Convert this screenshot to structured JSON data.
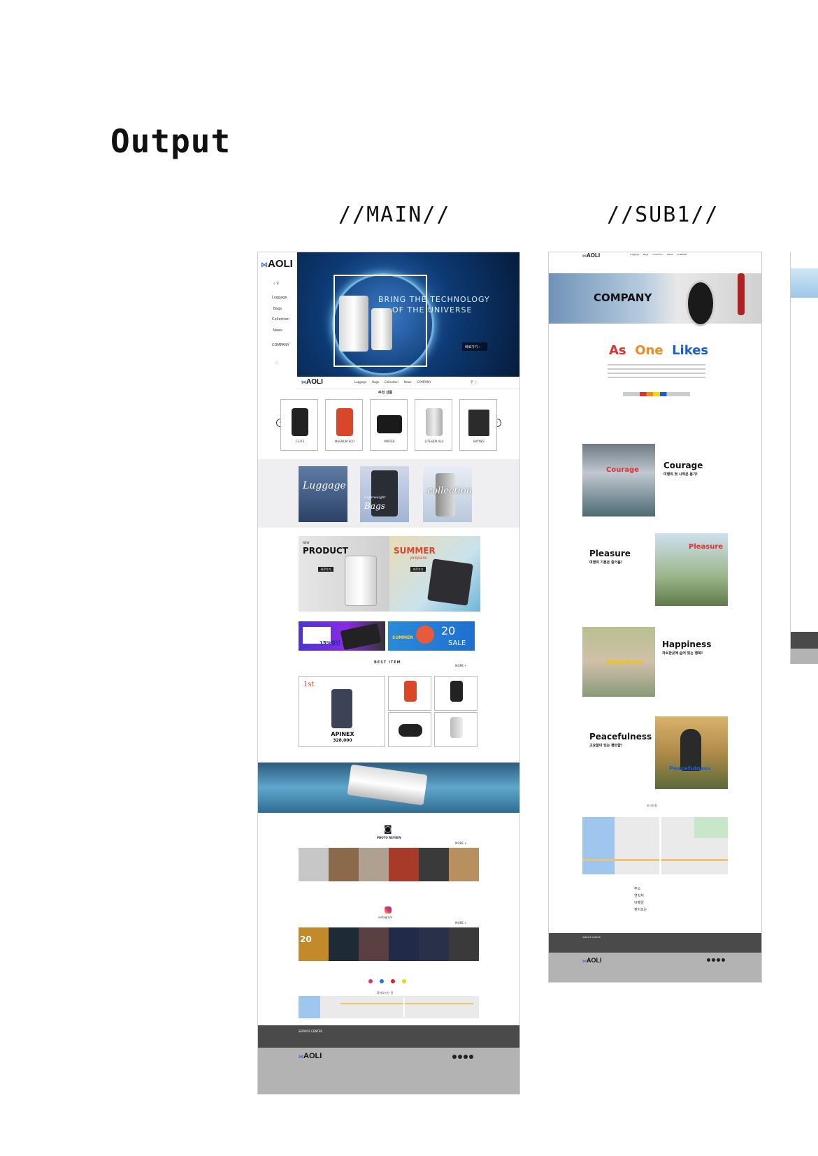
{
  "page": {
    "title": "Output",
    "columns": [
      "//MAIN//",
      "//SUB1//"
    ]
  },
  "main": {
    "brand": "AOLI",
    "sidebar_nav": [
      "Luggage",
      "Bags",
      "Collection",
      "News",
      "COMPANY"
    ],
    "top_nav": [
      "Luggage",
      "Bags",
      "Collection",
      "News",
      "COMPANY"
    ],
    "hero": {
      "line1": "BRING THE TECHNOLOGY",
      "line2": "OF THE UNIVERSE",
      "button": "바로가기"
    },
    "new_products_title": "추천 상품",
    "products": [
      {
        "name": "C-LITE"
      },
      {
        "name": "MAGNUM ECO"
      },
      {
        "name": "MINTER"
      },
      {
        "name": "LITE-BOX ALU"
      },
      {
        "name": "BAYNES"
      }
    ],
    "categories": [
      "Luggage",
      "Bags",
      "collection"
    ],
    "category_sub": [
      "Lightweight"
    ],
    "promo": {
      "new_label": "NEW",
      "product_label": "PRODUCT",
      "summer_label": "SUMMER",
      "summer_sub": "prepare",
      "button": "바로가기"
    },
    "banners": {
      "card_discount": "15%할인",
      "summer_sale_number": "20",
      "summer_sale_label": "SALE",
      "summer_word": "SUMMER"
    },
    "best_item": {
      "title": "BEST ITEM",
      "more": "MORE +",
      "first_rank": "1st",
      "first_name": "APINEX",
      "first_price": "328,000"
    },
    "photo_review": {
      "title": "PHOTO REVIEW",
      "more": "MORE +"
    },
    "instagram": {
      "title": "instagram",
      "more": "MORE +",
      "feed_number": "20"
    },
    "map_title": "찾아오시는 길",
    "footer": {
      "service_center": "SERVICE CENTER",
      "brand": "AOLI"
    },
    "colors": {
      "dark_footer": "#4a4a4a",
      "light_footer": "#b3b3b3",
      "hero_blue": "#0b3b72"
    }
  },
  "sub1": {
    "brand": "AOLI",
    "top_nav": [
      "Luggage",
      "Bags",
      "Collection",
      "News",
      "COMPANY"
    ],
    "banner_title": "COMPANY",
    "headline": {
      "as": "As",
      "one": "One",
      "likes": "Likes"
    },
    "sections": [
      {
        "title": "Courage",
        "subtitle": "여행의 첫 시작은 용기!",
        "image_label": "Courage"
      },
      {
        "title": "Pleasure",
        "subtitle": "여행의 기분은 즐거움!",
        "image_label": "Pleasure"
      },
      {
        "title": "Happiness",
        "subtitle": "자소한곳에 숨어 있는 행복!",
        "image_label": "Happiness"
      },
      {
        "title": "Peacefulness",
        "subtitle": "고요함이 있는 평안함!",
        "image_label": "Peacefulness"
      }
    ],
    "map_title": "오시는길",
    "info_labels": [
      "주소",
      "연락처",
      "이메일",
      "찾아오는"
    ],
    "footer": {
      "service_center": "SERVICE CENTER",
      "brand": "AOLI"
    },
    "colors": {
      "accent_red": "#e03030",
      "accent_orange": "#f08a1a",
      "accent_blue": "#1a5fd0"
    }
  }
}
